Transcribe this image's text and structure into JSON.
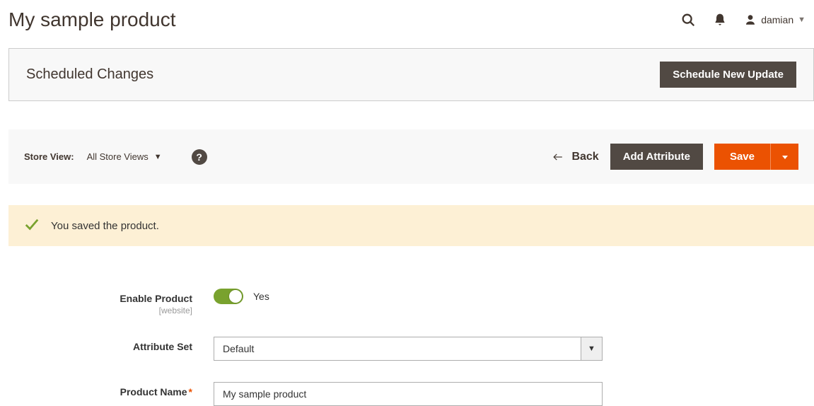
{
  "header": {
    "title": "My sample product",
    "username": "damian"
  },
  "scheduled": {
    "title": "Scheduled Changes",
    "button": "Schedule New Update"
  },
  "toolbar": {
    "store_view_label": "Store View:",
    "store_view_value": "All Store Views",
    "help_symbol": "?",
    "back_label": "Back",
    "add_attribute": "Add Attribute",
    "save": "Save"
  },
  "message": {
    "text": "You saved the product."
  },
  "form": {
    "enable_product": {
      "label": "Enable Product",
      "scope": "[website]",
      "value_text": "Yes"
    },
    "attribute_set": {
      "label": "Attribute Set",
      "value": "Default"
    },
    "product_name": {
      "label": "Product Name",
      "value": "My sample product"
    }
  }
}
